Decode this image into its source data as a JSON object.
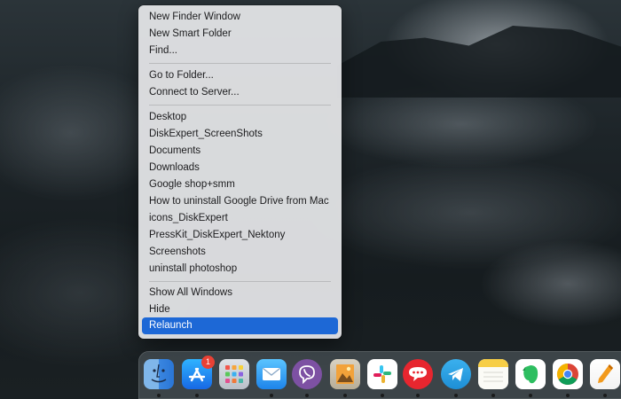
{
  "context_menu": {
    "items": [
      {
        "label": "New Finder Window"
      },
      {
        "label": "New Smart Folder"
      },
      {
        "label": "Find..."
      },
      {
        "label": "Go to Folder..."
      },
      {
        "label": "Connect to Server..."
      },
      {
        "label": "Desktop"
      },
      {
        "label": "DiskExpert_ScreenShots"
      },
      {
        "label": "Documents"
      },
      {
        "label": "Downloads"
      },
      {
        "label": "Google shop+smm"
      },
      {
        "label": "How to uninstall Google Drive from Mac"
      },
      {
        "label": "icons_DiskExpert"
      },
      {
        "label": "PressKit_DiskExpert_Nektony"
      },
      {
        "label": "Screenshots"
      },
      {
        "label": "uninstall photoshop"
      },
      {
        "label": "Show All Windows"
      },
      {
        "label": "Hide"
      },
      {
        "label": "Relaunch",
        "highlighted": true
      }
    ]
  },
  "dock": {
    "apps": [
      {
        "icon": "finder-icon",
        "running": true
      },
      {
        "icon": "app-store-icon",
        "running": true,
        "badge": "1"
      },
      {
        "icon": "launchpad-icon",
        "running": false
      },
      {
        "icon": "mail-icon",
        "running": true
      },
      {
        "icon": "viber-icon",
        "running": true
      },
      {
        "icon": "preview-icon",
        "running": true
      },
      {
        "icon": "slack-icon",
        "running": true
      },
      {
        "icon": "speechbubble-icon",
        "running": true
      },
      {
        "icon": "telegram-icon",
        "running": true
      },
      {
        "icon": "notes-icon",
        "running": true
      },
      {
        "icon": "evernote-icon",
        "running": true
      },
      {
        "icon": "chrome-icon",
        "running": true
      },
      {
        "icon": "pages-icon",
        "running": true
      }
    ]
  },
  "colors": {
    "highlight": "#1d68d6",
    "badge": "#e84135"
  }
}
